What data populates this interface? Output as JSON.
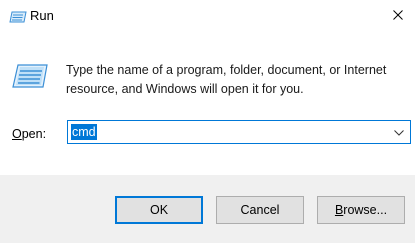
{
  "window": {
    "title": "Run",
    "icon": "run-icon",
    "close_icon": "close-icon"
  },
  "body": {
    "icon": "run-icon",
    "description": "Type the name of a program, folder, document, or Internet resource, and Windows will open it for you."
  },
  "open": {
    "label_accesskey": "O",
    "label_rest": "pen:",
    "value": "cmd",
    "dropdown_icon": "chevron-down-icon"
  },
  "buttons": {
    "ok": "OK",
    "cancel": "Cancel",
    "browse_accesskey": "B",
    "browse_rest": "rowse..."
  },
  "colors": {
    "accent": "#0078d7",
    "footer_bg": "#f0f0f0",
    "button_bg": "#e1e1e1"
  }
}
